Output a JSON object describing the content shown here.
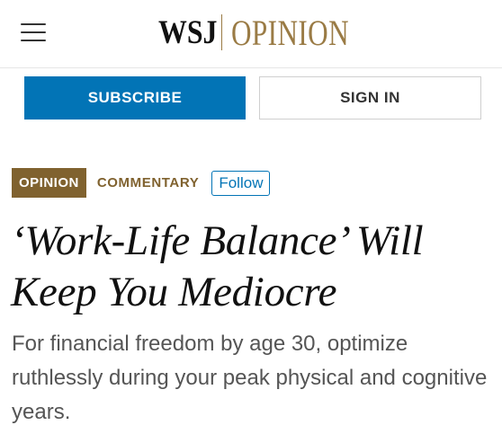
{
  "header": {
    "menu_icon": "hamburger-menu-icon",
    "brand": "WSJ",
    "section": "OPINION",
    "brand_color": "#111111",
    "section_color": "#9a7b45"
  },
  "actions": {
    "subscribe_label": "SUBSCRIBE",
    "signin_label": "SIGN IN",
    "subscribe_color": "#0274b6"
  },
  "tags": {
    "opinion": "OPINION",
    "commentary": "COMMENTARY",
    "follow": "Follow",
    "tag_color": "#80622f"
  },
  "article": {
    "headline": "‘Work-Life Balance’ Will Keep You Mediocre",
    "dek": "For financial freedom by age 30, optimize ruthlessly during your peak physical and cognitive years."
  }
}
